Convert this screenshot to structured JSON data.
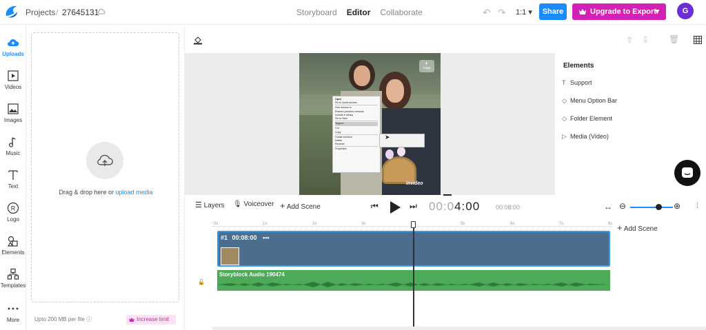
{
  "topbar": {
    "breadcrumb_root": "Projects",
    "breadcrumb_sep": "/",
    "project_id": "27645131",
    "tabs": [
      {
        "label": "Storyboard",
        "active": false
      },
      {
        "label": "Editor",
        "active": true
      },
      {
        "label": "Collaborate",
        "active": false
      }
    ],
    "aspect_ratio": "1:1",
    "share_label": "Share",
    "upgrade_label": "Upgrade to Export",
    "avatar_initial": "G",
    "accent_blue": "#1a8cff",
    "accent_magenta": "#d321b5"
  },
  "leftnav": {
    "items": [
      {
        "label": "Uploads",
        "icon": "cloud-upload-icon",
        "active": true
      },
      {
        "label": "Videos",
        "icon": "video-icon",
        "active": false
      },
      {
        "label": "Images",
        "icon": "image-icon",
        "active": false
      },
      {
        "label": "Music",
        "icon": "music-note-icon",
        "active": false
      },
      {
        "label": "Text",
        "icon": "text-icon",
        "active": false
      },
      {
        "label": "Logo",
        "icon": "registered-icon",
        "active": false
      },
      {
        "label": "Elements",
        "icon": "shapes-icon",
        "active": false
      },
      {
        "label": "Templates",
        "icon": "templates-icon",
        "active": false
      },
      {
        "label": "More",
        "icon": "more-dots-icon",
        "active": false
      }
    ]
  },
  "uploads": {
    "drop_text": "Drag & drop here or",
    "upload_link": "upload media",
    "limit_note": "Upto 200 MB per file",
    "increase_label": "Increase limit"
  },
  "preview": {
    "watermark_label": "Logo",
    "brand_watermark": "invideo",
    "context_menu": [
      "Open",
      "Pin to Quick access",
      "",
      "Give access to",
      "Restore previous versions",
      "Include in library",
      "Pin to Start",
      "",
      "Support",
      "",
      "Cut",
      "Copy",
      "",
      "Create shortcut",
      "Delete",
      "Rename",
      "",
      "Properties"
    ]
  },
  "elements_panel": {
    "title": "Elements",
    "items": [
      {
        "label": "Support",
        "icon": "text-type-icon"
      },
      {
        "label": "Menu Option Bar",
        "icon": "diamond-icon"
      },
      {
        "label": "Folder Element",
        "icon": "diamond-icon"
      },
      {
        "label": "Media (Video)",
        "icon": "play-triangle-icon"
      }
    ]
  },
  "controls": {
    "layers_label": "Layers",
    "voiceover_label": "Voiceover",
    "add_scene_label": "Add Scene",
    "current_time_dim": "00:0",
    "current_time_bright": "4:00",
    "total_time": "00:08:00"
  },
  "timeline": {
    "ticks": [
      "0s",
      "1s",
      "2s",
      "3s",
      "4s",
      "5s",
      "6s",
      "7s",
      "8s"
    ],
    "add_scene_label": "Add Scene",
    "scene_label": "#1",
    "scene_duration": "00:08:00",
    "scene_menu": "•••",
    "audio_label": "Storyblock Audio 190474"
  }
}
